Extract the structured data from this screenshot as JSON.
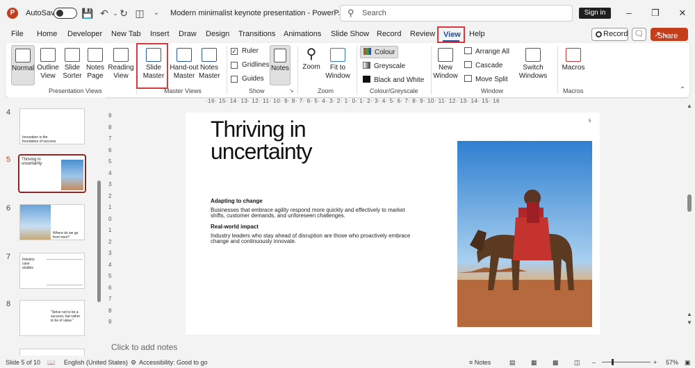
{
  "titlebar": {
    "autosave_label": "AutoSave",
    "doc_title": "Modern minimalist keynote presentation  -  PowerP...",
    "search_placeholder": "Search",
    "sign_in": "Sign in"
  },
  "menu": {
    "items": [
      "File",
      "Home",
      "Developer",
      "New Tab",
      "Insert",
      "Draw",
      "Design",
      "Transitions",
      "Animations",
      "Slide Show",
      "Record",
      "Review"
    ],
    "view": "View",
    "help": "Help",
    "record_button": "Record",
    "share_button": "Share"
  },
  "ribbon": {
    "presentation_views": {
      "label": "Presentation Views",
      "normal": "Normal",
      "outline_view": "Outline View",
      "slide_sorter": "Slide Sorter",
      "notes_page": "Notes Page",
      "reading_view": "Reading View"
    },
    "master_views": {
      "label": "Master Views",
      "slide_master": "Slide Master",
      "handout_master": "Hand-out Master",
      "notes_master": "Notes Master"
    },
    "show": {
      "label": "Show",
      "ruler": "Ruler",
      "gridlines": "Gridlines",
      "guides": "Guides",
      "notes": "Notes"
    },
    "zoom": {
      "label": "Zoom",
      "zoom": "Zoom",
      "fit_to_window": "Fit to Window"
    },
    "colour": {
      "label": "Colour/Greyscale",
      "colour": "Colour",
      "greyscale": "Greyscale",
      "black_and_white": "Black and White"
    },
    "window": {
      "label": "Window",
      "new_window": "New Window",
      "arrange_all": "Arrange All",
      "cascade": "Cascade",
      "move_split": "Move Split",
      "switch_windows": "Switch Windows"
    },
    "macros": {
      "label": "Macros",
      "macros": "Macros"
    }
  },
  "thumbnails": [
    {
      "num": "4",
      "text": "Innovation is the foundation of success"
    },
    {
      "num": "5",
      "text": "Thriving in uncertainty"
    },
    {
      "num": "6",
      "text": "Where do we go from here?"
    },
    {
      "num": "7",
      "text": "Industry case studies"
    },
    {
      "num": "8",
      "text": "\"Strive not to be a success, but rather to be of value.\""
    }
  ],
  "ruler": {
    "horizontal": "·16· 15· 14· 13· 12· 11· 10· 9· 8· 7· 6· 5· 4· 3· 2· 1· 0· 1· 2· 3· 4· 5· 6· 7· 8· 9· 10· 11· 12· 13· 14· 15· 16",
    "vertical": [
      "9",
      "8",
      "7",
      "6",
      "5",
      "4",
      "3",
      "2",
      "1",
      "0",
      "1",
      "2",
      "3",
      "4",
      "5",
      "6",
      "7",
      "8",
      "9"
    ]
  },
  "slide": {
    "title_line1": "Thriving in",
    "title_line2": "uncertainty",
    "number": "5",
    "heading1": "Adapting to change",
    "body1": "Businesses that embrace agility respond more quickly and effectively to market shifts, customer demands, and unforeseen challenges.",
    "heading2": "Real-world impact",
    "body2": "Industry leaders who stay ahead of disruption are those who proactively embrace change and continuously innovate."
  },
  "notes_placeholder": "Click to add notes",
  "status": {
    "slide_of": "Slide 5 of 10",
    "language": "English (United States)",
    "accessibility": "Accessibility: Good to go",
    "notes": "Notes",
    "zoom_level": "57%"
  }
}
